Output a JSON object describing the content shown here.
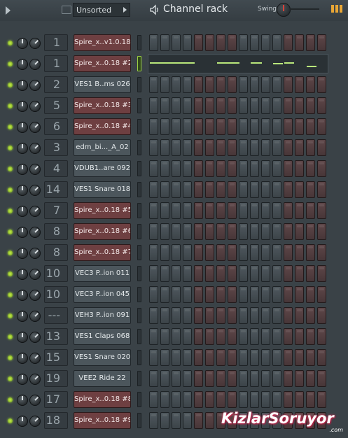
{
  "toolbar": {
    "filter_value": "Unsorted",
    "title": "Channel rack",
    "swing_label": "Swing"
  },
  "colors": {
    "accent_green": "#9cd242",
    "channel_red": "#6e3f41",
    "channel_gray": "#4c565c"
  },
  "channels": [
    {
      "mixer": "1",
      "name": "Spire_x..v1.0.18",
      "color": "red",
      "selected": false,
      "pianoroll": false
    },
    {
      "mixer": "1",
      "name": "Spire_x..0.18 #2",
      "color": "red",
      "selected": true,
      "pianoroll": true
    },
    {
      "mixer": "2",
      "name": "VES1 B..ms 026",
      "color": "gray",
      "selected": false,
      "pianoroll": false
    },
    {
      "mixer": "5",
      "name": "Spire_x..0.18 #3",
      "color": "red",
      "selected": false,
      "pianoroll": false
    },
    {
      "mixer": "6",
      "name": "Spire_x..0.18 #4",
      "color": "red",
      "selected": false,
      "pianoroll": false
    },
    {
      "mixer": "3",
      "name": "edm_bi..._A_02",
      "color": "gray",
      "selected": false,
      "pianoroll": false
    },
    {
      "mixer": "4",
      "name": "VDUB1..are 092",
      "color": "gray",
      "selected": false,
      "pianoroll": false
    },
    {
      "mixer": "14",
      "name": "VES1 Snare 018",
      "color": "gray",
      "selected": false,
      "pianoroll": false
    },
    {
      "mixer": "7",
      "name": "Spire_x..0.18 #5",
      "color": "red",
      "selected": false,
      "pianoroll": false
    },
    {
      "mixer": "8",
      "name": "Spire_x..0.18 #6",
      "color": "red",
      "selected": false,
      "pianoroll": false
    },
    {
      "mixer": "8",
      "name": "Spire_x..0.18 #7",
      "color": "red",
      "selected": false,
      "pianoroll": false
    },
    {
      "mixer": "10",
      "name": "VEC3 P..ion 011",
      "color": "gray",
      "selected": false,
      "pianoroll": false
    },
    {
      "mixer": "10",
      "name": "VEC3 P..ion 045",
      "color": "gray",
      "selected": false,
      "pianoroll": false
    },
    {
      "mixer": "---",
      "name": "VEH3 P..ion 091",
      "color": "gray",
      "selected": false,
      "pianoroll": false
    },
    {
      "mixer": "13",
      "name": "VES1 Claps 068",
      "color": "gray",
      "selected": false,
      "pianoroll": false
    },
    {
      "mixer": "15",
      "name": "VES1 Snare 020",
      "color": "gray",
      "selected": false,
      "pianoroll": false
    },
    {
      "mixer": "19",
      "name": "VEE2 Ride 22",
      "color": "gray",
      "selected": false,
      "pianoroll": false
    },
    {
      "mixer": "17",
      "name": "Spire_x..0.18 #8",
      "color": "red",
      "selected": false,
      "pianoroll": false
    },
    {
      "mixer": "18",
      "name": "Spire_x..0.18 #9",
      "color": "red",
      "selected": false,
      "pianoroll": false
    }
  ],
  "watermark": {
    "text": "KizlarSoruyor",
    "sub": ".com"
  }
}
